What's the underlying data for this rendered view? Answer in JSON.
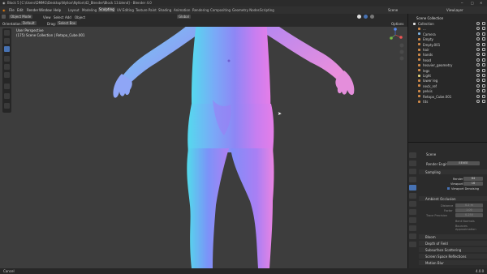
{
  "titlebar": {
    "title": "Block 5 [C:\\Users\\DMMG\\Desktop\\Nyllon\\Nyllon\\42_Blender\\Block 13.blend] - Blender 4.0"
  },
  "menubar": {
    "menus": [
      "File",
      "Edit",
      "Render",
      "Window",
      "Help"
    ],
    "workspaces": [
      "Layout",
      "Modeling",
      "Sculpting",
      "UV Editing",
      "Texture Paint",
      "Shading",
      "Animation",
      "Rendering",
      "Compositing",
      "Geometry Nodes",
      "Scripting"
    ],
    "active_workspace": "Sculpting",
    "scene": "Scene",
    "view_layer": "ViewLayer"
  },
  "header3d": {
    "mode": "Object Mode",
    "menus": [
      "View",
      "Select",
      "Add",
      "Object"
    ],
    "transform": "Global",
    "options": "Options"
  },
  "tool3d": {
    "orientation_label": "Orientation:",
    "orientation": "Default",
    "drag_label": "Drag:",
    "drag": "Select Box"
  },
  "viewport": {
    "view_name": "User Perspective",
    "collection_info": "(175) Scene Collection | Retopo_Cube.001"
  },
  "outliner": {
    "title": "Scene Collection",
    "items": [
      {
        "label": "Collection",
        "color": "#e0e0e0"
      },
      {
        "label": "...",
        "color": "#d08a4a"
      },
      {
        "label": "Camera",
        "color": "#7fb2e0"
      },
      {
        "label": "Empty",
        "color": "#d08a4a"
      },
      {
        "label": "Empty.001",
        "color": "#d08a4a"
      },
      {
        "label": "hair",
        "color": "#d08a4a"
      },
      {
        "label": "hands",
        "color": "#d08a4a"
      },
      {
        "label": "head",
        "color": "#d08a4a"
      },
      {
        "label": "heavier_geometry",
        "color": "#d08a4a"
      },
      {
        "label": "legs",
        "color": "#d08a4a"
      },
      {
        "label": "Light",
        "color": "#e0d07a"
      },
      {
        "label": "lower leg",
        "color": "#d08a4a"
      },
      {
        "label": "neck_ref",
        "color": "#d08a4a"
      },
      {
        "label": "pelvis",
        "color": "#d08a4a"
      },
      {
        "label": "Retopo_Cube.001",
        "color": "#d08a4a"
      },
      {
        "label": "tits",
        "color": "#d08a4a"
      }
    ]
  },
  "properties": {
    "header": "Scene",
    "render_engine_label": "Render Engine",
    "render_engine": "EEVEE",
    "sampling": "Sampling",
    "render_label": "Render",
    "render_value": "64",
    "viewport_label": "Viewport",
    "viewport_value": "16",
    "viewport_denoising": "Viewport Denoising",
    "ambient_occlusion": "Ambient Occlusion",
    "distance_label": "Distance",
    "distance_value": "0.2 m",
    "factor_label": "Factor",
    "factor_value": "1.00",
    "trace_precision_label": "Trace Precision",
    "trace_precision_value": "0.250",
    "bent_normals": "Bent Normals",
    "bounces_approx": "Bounces Approximation",
    "bloom": "Bloom",
    "depth_of_field": "Depth of Field",
    "subsurface": "Subsurface Scattering",
    "ssr": "Screen Space Reflections",
    "motion_blur": "Motion Blur"
  },
  "status": {
    "left": "Cancel",
    "right": "4.0.0"
  }
}
